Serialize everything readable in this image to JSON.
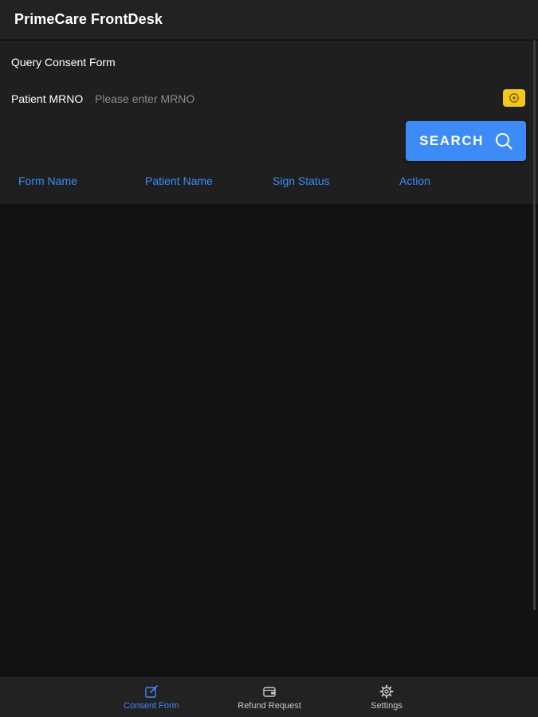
{
  "header": {
    "title": "PrimeCare FrontDesk"
  },
  "query": {
    "section_title": "Query Consent Form",
    "mrno_label": "Patient MRNO",
    "mrno_value": "",
    "mrno_placeholder": "Please enter MRNO",
    "search_label": "SEARCH",
    "scan_icon": "scan-icon"
  },
  "table": {
    "columns": [
      "Form Name",
      "Patient Name",
      "Sign Status",
      "Action"
    ],
    "rows": []
  },
  "bottom_nav": {
    "items": [
      {
        "label": "Consent Form",
        "icon": "edit-icon",
        "active": true
      },
      {
        "label": "Refund Request",
        "icon": "wallet-icon",
        "active": false
      },
      {
        "label": "Settings",
        "icon": "gear-icon",
        "active": false
      }
    ]
  },
  "colors": {
    "accent": "#3d8bf7",
    "scan_button": "#f2c81f",
    "header_bg": "#222222",
    "panel_bg": "#1f1f1f",
    "content_bg": "#121212"
  }
}
